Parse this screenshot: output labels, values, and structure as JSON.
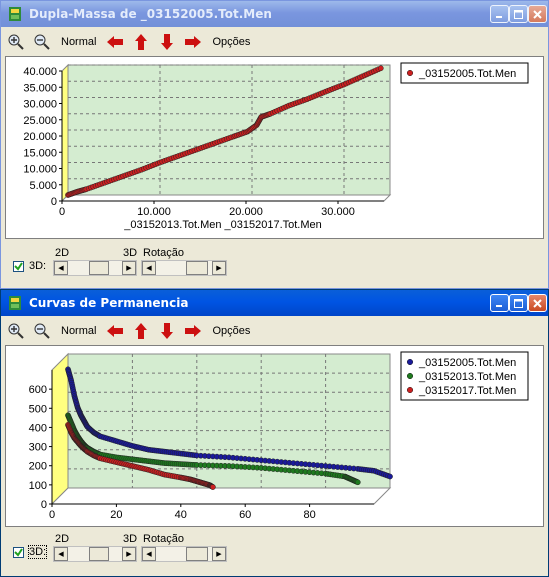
{
  "colors": {
    "plot_bg": "#d4ecd0",
    "wall": "#ffff80",
    "red": "#cc2020",
    "green": "#1e7a1e",
    "blue": "#1a1a9a"
  },
  "windows": [
    {
      "title": "Dupla-Massa de _03152005.Tot.Men",
      "toolbar": {
        "zoom_in": "zoom-in-icon",
        "zoom_out": "zoom-out-icon",
        "normal": "Normal",
        "left": "arrow-left-icon",
        "up": "arrow-up-icon",
        "down": "arrow-down-icon",
        "right": "arrow-right-icon",
        "options": "Opções"
      },
      "checkbox_label": "3D:",
      "label_2d": "2D",
      "label_3d": "3D",
      "label_rotation": "Rotação"
    },
    {
      "title": "Curvas de Permanencia",
      "toolbar": {
        "zoom_in": "zoom-in-icon",
        "zoom_out": "zoom-out-icon",
        "normal": "Normal",
        "left": "arrow-left-icon",
        "up": "arrow-up-icon",
        "down": "arrow-down-icon",
        "right": "arrow-right-icon",
        "options": "Opções"
      },
      "checkbox_label": "3D:",
      "label_2d": "2D",
      "label_3d": "3D",
      "label_rotation": "Rotação"
    }
  ],
  "chart_data": [
    {
      "type": "scatter",
      "title": "",
      "xlabel": "_03152013.Tot.Men _03152017.Tot.Men",
      "ylabel": "",
      "xlim": [
        0,
        35000
      ],
      "ylim": [
        0,
        40000
      ],
      "x_ticks": [
        "0",
        "10.000",
        "20.000",
        "30.000"
      ],
      "y_ticks": [
        "0",
        "5.000",
        "10.000",
        "15.000",
        "20.000",
        "25.000",
        "30.000",
        "35.000",
        "40.000"
      ],
      "grid": true,
      "legend_position": "top-right",
      "series": [
        {
          "name": "_03152005.Tot.Men",
          "color": "red",
          "x": [
            0,
            1000,
            2000,
            4000,
            6000,
            8000,
            10000,
            12000,
            14000,
            16000,
            18000,
            19500,
            20500,
            21000,
            22000,
            24000,
            26000,
            28000,
            30000,
            32000,
            34000
          ],
          "y": [
            0,
            1000,
            1800,
            3800,
            5800,
            7800,
            10000,
            12000,
            14000,
            16000,
            18000,
            19500,
            21500,
            24000,
            25000,
            27500,
            29500,
            31800,
            34000,
            36500,
            39000
          ]
        }
      ]
    },
    {
      "type": "scatter",
      "title": "",
      "xlabel": "",
      "ylabel": "",
      "xlim": [
        0,
        100
      ],
      "ylim": [
        0,
        700
      ],
      "x_ticks": [
        "0",
        "20",
        "40",
        "60",
        "80"
      ],
      "y_ticks": [
        "0",
        "100",
        "200",
        "300",
        "400",
        "500",
        "600"
      ],
      "grid": true,
      "legend_position": "top-right",
      "series": [
        {
          "name": "_03152005.Tot.Men",
          "color": "blue",
          "x": [
            0,
            1,
            2,
            3,
            4,
            5,
            6,
            8,
            10,
            15,
            20,
            25,
            30,
            35,
            40,
            50,
            60,
            70,
            80,
            90,
            95,
            100
          ],
          "y": [
            620,
            560,
            480,
            420,
            380,
            350,
            320,
            290,
            270,
            245,
            220,
            200,
            190,
            180,
            170,
            160,
            145,
            130,
            115,
            100,
            90,
            60
          ]
        },
        {
          "name": "_03152013.Tot.Men",
          "color": "green",
          "x": [
            0,
            1,
            2,
            3,
            4,
            5,
            6,
            8,
            10,
            15,
            20,
            25,
            30,
            35,
            40,
            50,
            60,
            70,
            80,
            86,
            88,
            90
          ],
          "y": [
            380,
            340,
            300,
            270,
            245,
            225,
            210,
            190,
            175,
            160,
            150,
            140,
            130,
            125,
            120,
            115,
            105,
            90,
            75,
            60,
            45,
            30
          ]
        },
        {
          "name": "_03152017.Tot.Men",
          "color": "red",
          "x": [
            0,
            1,
            2,
            3,
            4,
            5,
            6,
            8,
            10,
            15,
            20,
            25,
            30,
            35,
            38,
            40,
            42,
            44,
            45
          ],
          "y": [
            330,
            290,
            260,
            240,
            220,
            205,
            190,
            170,
            155,
            135,
            115,
            95,
            70,
            55,
            45,
            35,
            25,
            15,
            5
          ]
        }
      ]
    }
  ]
}
